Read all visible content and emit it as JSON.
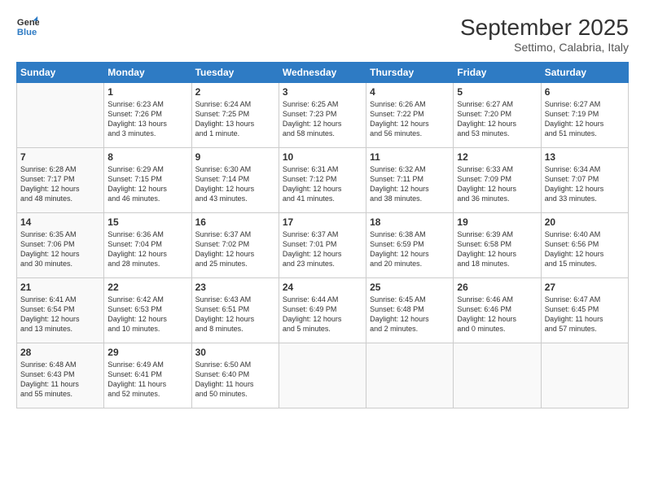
{
  "logo": {
    "line1": "General",
    "line2": "Blue"
  },
  "title": "September 2025",
  "subtitle": "Settimo, Calabria, Italy",
  "days_header": [
    "Sunday",
    "Monday",
    "Tuesday",
    "Wednesday",
    "Thursday",
    "Friday",
    "Saturday"
  ],
  "weeks": [
    [
      {
        "day": "",
        "info": ""
      },
      {
        "day": "1",
        "info": "Sunrise: 6:23 AM\nSunset: 7:26 PM\nDaylight: 13 hours\nand 3 minutes."
      },
      {
        "day": "2",
        "info": "Sunrise: 6:24 AM\nSunset: 7:25 PM\nDaylight: 13 hours\nand 1 minute."
      },
      {
        "day": "3",
        "info": "Sunrise: 6:25 AM\nSunset: 7:23 PM\nDaylight: 12 hours\nand 58 minutes."
      },
      {
        "day": "4",
        "info": "Sunrise: 6:26 AM\nSunset: 7:22 PM\nDaylight: 12 hours\nand 56 minutes."
      },
      {
        "day": "5",
        "info": "Sunrise: 6:27 AM\nSunset: 7:20 PM\nDaylight: 12 hours\nand 53 minutes."
      },
      {
        "day": "6",
        "info": "Sunrise: 6:27 AM\nSunset: 7:19 PM\nDaylight: 12 hours\nand 51 minutes."
      }
    ],
    [
      {
        "day": "7",
        "info": "Sunrise: 6:28 AM\nSunset: 7:17 PM\nDaylight: 12 hours\nand 48 minutes."
      },
      {
        "day": "8",
        "info": "Sunrise: 6:29 AM\nSunset: 7:15 PM\nDaylight: 12 hours\nand 46 minutes."
      },
      {
        "day": "9",
        "info": "Sunrise: 6:30 AM\nSunset: 7:14 PM\nDaylight: 12 hours\nand 43 minutes."
      },
      {
        "day": "10",
        "info": "Sunrise: 6:31 AM\nSunset: 7:12 PM\nDaylight: 12 hours\nand 41 minutes."
      },
      {
        "day": "11",
        "info": "Sunrise: 6:32 AM\nSunset: 7:11 PM\nDaylight: 12 hours\nand 38 minutes."
      },
      {
        "day": "12",
        "info": "Sunrise: 6:33 AM\nSunset: 7:09 PM\nDaylight: 12 hours\nand 36 minutes."
      },
      {
        "day": "13",
        "info": "Sunrise: 6:34 AM\nSunset: 7:07 PM\nDaylight: 12 hours\nand 33 minutes."
      }
    ],
    [
      {
        "day": "14",
        "info": "Sunrise: 6:35 AM\nSunset: 7:06 PM\nDaylight: 12 hours\nand 30 minutes."
      },
      {
        "day": "15",
        "info": "Sunrise: 6:36 AM\nSunset: 7:04 PM\nDaylight: 12 hours\nand 28 minutes."
      },
      {
        "day": "16",
        "info": "Sunrise: 6:37 AM\nSunset: 7:02 PM\nDaylight: 12 hours\nand 25 minutes."
      },
      {
        "day": "17",
        "info": "Sunrise: 6:37 AM\nSunset: 7:01 PM\nDaylight: 12 hours\nand 23 minutes."
      },
      {
        "day": "18",
        "info": "Sunrise: 6:38 AM\nSunset: 6:59 PM\nDaylight: 12 hours\nand 20 minutes."
      },
      {
        "day": "19",
        "info": "Sunrise: 6:39 AM\nSunset: 6:58 PM\nDaylight: 12 hours\nand 18 minutes."
      },
      {
        "day": "20",
        "info": "Sunrise: 6:40 AM\nSunset: 6:56 PM\nDaylight: 12 hours\nand 15 minutes."
      }
    ],
    [
      {
        "day": "21",
        "info": "Sunrise: 6:41 AM\nSunset: 6:54 PM\nDaylight: 12 hours\nand 13 minutes."
      },
      {
        "day": "22",
        "info": "Sunrise: 6:42 AM\nSunset: 6:53 PM\nDaylight: 12 hours\nand 10 minutes."
      },
      {
        "day": "23",
        "info": "Sunrise: 6:43 AM\nSunset: 6:51 PM\nDaylight: 12 hours\nand 8 minutes."
      },
      {
        "day": "24",
        "info": "Sunrise: 6:44 AM\nSunset: 6:49 PM\nDaylight: 12 hours\nand 5 minutes."
      },
      {
        "day": "25",
        "info": "Sunrise: 6:45 AM\nSunset: 6:48 PM\nDaylight: 12 hours\nand 2 minutes."
      },
      {
        "day": "26",
        "info": "Sunrise: 6:46 AM\nSunset: 6:46 PM\nDaylight: 12 hours\nand 0 minutes."
      },
      {
        "day": "27",
        "info": "Sunrise: 6:47 AM\nSunset: 6:45 PM\nDaylight: 11 hours\nand 57 minutes."
      }
    ],
    [
      {
        "day": "28",
        "info": "Sunrise: 6:48 AM\nSunset: 6:43 PM\nDaylight: 11 hours\nand 55 minutes."
      },
      {
        "day": "29",
        "info": "Sunrise: 6:49 AM\nSunset: 6:41 PM\nDaylight: 11 hours\nand 52 minutes."
      },
      {
        "day": "30",
        "info": "Sunrise: 6:50 AM\nSunset: 6:40 PM\nDaylight: 11 hours\nand 50 minutes."
      },
      {
        "day": "",
        "info": ""
      },
      {
        "day": "",
        "info": ""
      },
      {
        "day": "",
        "info": ""
      },
      {
        "day": "",
        "info": ""
      }
    ]
  ]
}
